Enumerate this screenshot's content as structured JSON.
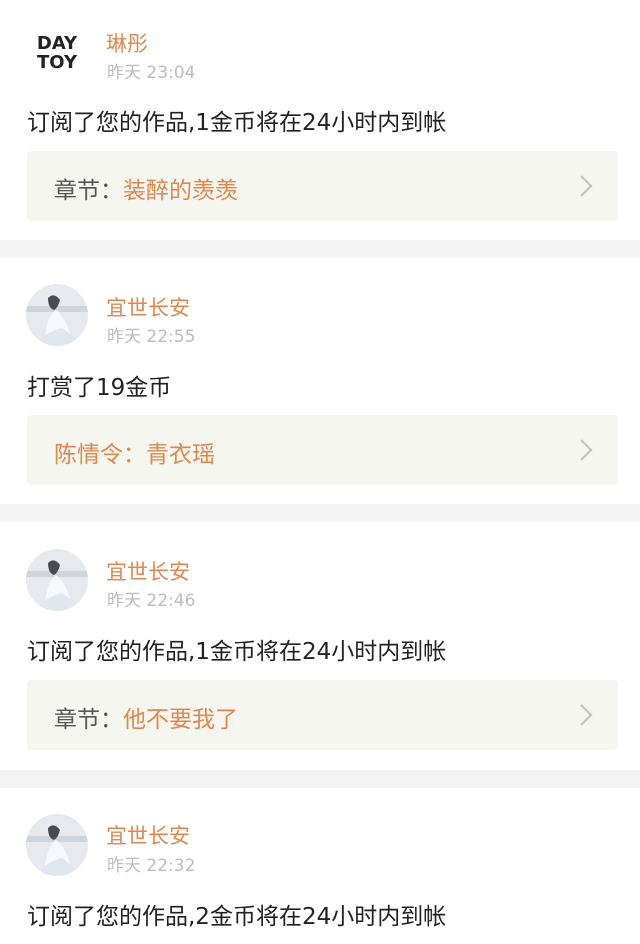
{
  "entries": [
    {
      "avatar": "daytoy-logo",
      "avatar_logo_lines": [
        "DAY",
        "TOY"
      ],
      "username": "琳彤",
      "time": "昨天 23:04",
      "message": "订阅了您的作品,1金币将在24小时内到帐",
      "link": {
        "prefix": "章节：",
        "title": "装醉的羡羡"
      }
    },
    {
      "avatar": "girl-in-white-image",
      "username": "宜世长安",
      "time": "昨天 22:55",
      "message": "打赏了19金币",
      "link": {
        "prefix": "陈情令：",
        "title": "青衣瑶"
      }
    },
    {
      "avatar": "girl-in-white-image",
      "username": "宜世长安",
      "time": "昨天 22:46",
      "message": "订阅了您的作品,1金币将在24小时内到帐",
      "link": {
        "prefix": "章节：",
        "title": "他不要我了"
      }
    },
    {
      "avatar": "girl-in-white-image",
      "username": "宜世长安",
      "time": "昨天 22:32",
      "message": "订阅了您的作品,2金币将在24小时内到帐"
    }
  ],
  "icons": {
    "link_arrow": "chevron-right-icon"
  },
  "colors": {
    "accent": "#e0874e",
    "link_bg": "#f6f6f0",
    "separator": "#f3f3f3",
    "time": "#bdbdbd"
  }
}
